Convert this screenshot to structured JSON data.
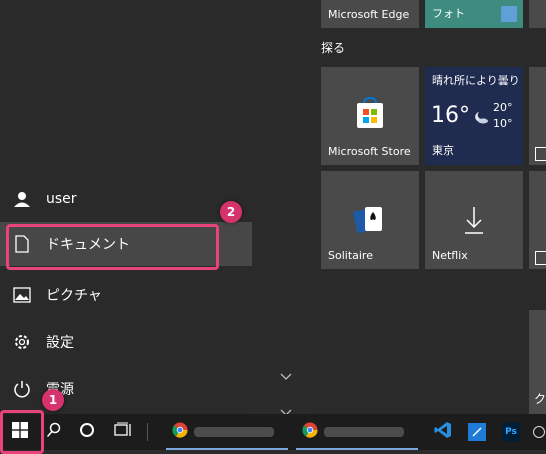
{
  "sidebar": {
    "user": "user",
    "documents": "ドキュメント",
    "pictures": "ピクチャ",
    "settings": "設定",
    "power": "電源"
  },
  "tiles": {
    "group_explore": "探る",
    "edge": "Microsoft Edge",
    "photos": "フォト",
    "store": "Microsoft Store",
    "weather": {
      "condition": "晴れ所により曇り",
      "temp": "16°",
      "high": "20°",
      "low": "10°",
      "city": "東京"
    },
    "solitaire": "Solitaire",
    "netflix": "Netflix",
    "partial_bottom": "ク"
  },
  "annotations": {
    "marker1": "1",
    "marker2": "2"
  },
  "colors": {
    "accent_pink": "#e8437a",
    "store_blue": "#0078d7",
    "weather_bg": "#1f2b4f",
    "vscode_blue": "#2a8ee0",
    "ps_bg": "#001e36"
  }
}
